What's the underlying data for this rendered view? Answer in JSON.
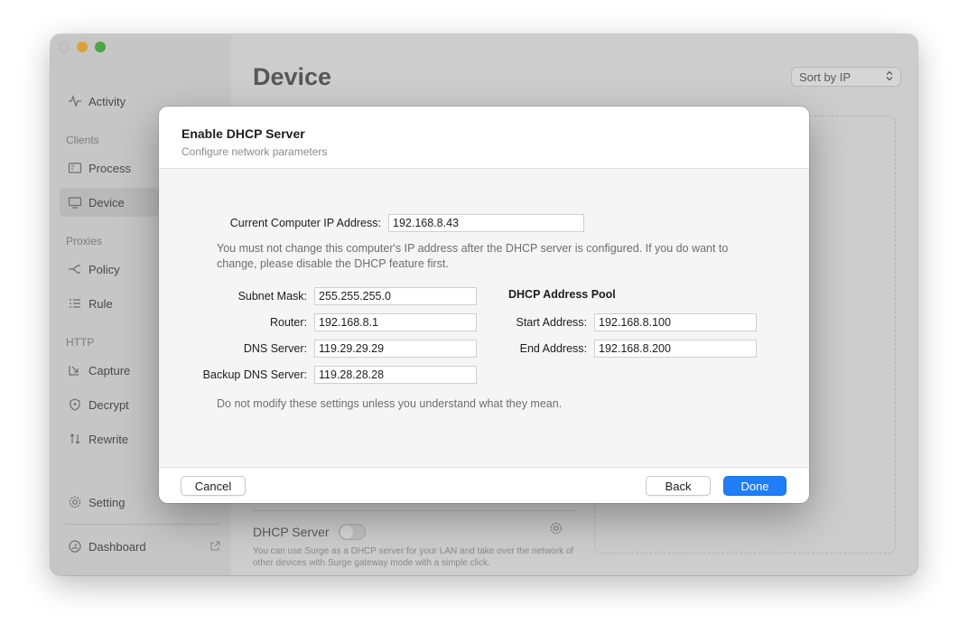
{
  "sidebar": {
    "items": [
      {
        "key": "activity",
        "label": "Activity",
        "icon": "pulse-icon"
      },
      {
        "key": "process",
        "label": "Process",
        "icon": "process-window-icon"
      },
      {
        "key": "device",
        "label": "Device",
        "icon": "monitor-icon",
        "active": true
      },
      {
        "key": "policy",
        "label": "Policy",
        "icon": "policy-branch-icon"
      },
      {
        "key": "rule",
        "label": "Rule",
        "icon": "rule-list-icon"
      },
      {
        "key": "capture",
        "label": "Capture",
        "icon": "capture-icon"
      },
      {
        "key": "decrypt",
        "label": "Decrypt",
        "icon": "shield-icon"
      },
      {
        "key": "rewrite",
        "label": "Rewrite",
        "icon": "rewrite-arrows-icon"
      },
      {
        "key": "setting",
        "label": "Setting",
        "icon": "gear-icon"
      },
      {
        "key": "dashboard",
        "label": "Dashboard",
        "icon": "dashboard-icon"
      }
    ],
    "sections": {
      "clients": "Clients",
      "proxies": "Proxies",
      "http": "HTTP"
    }
  },
  "main": {
    "title": "Device",
    "sort_value": "Sort by IP",
    "dhcp_title": "DHCP Server",
    "dhcp_toggle_on": false,
    "dhcp_desc": "You can use Surge as a DHCP server for your LAN and take over the network of other devices with Surge gateway mode with a simple click."
  },
  "dialog": {
    "title": "Enable DHCP Server",
    "subtitle": "Configure network parameters",
    "current_ip_label": "Current Computer IP Address:",
    "current_ip_value": "192.168.8.43",
    "ip_note": "You must not change this computer's IP address after the DHCP server is configured. If you do want to change, please disable the DHCP feature first.",
    "subnet_label": "Subnet Mask:",
    "subnet_value": "255.255.255.0",
    "router_label": "Router:",
    "router_value": "192.168.8.1",
    "dns_label": "DNS Server:",
    "dns_value": "119.29.29.29",
    "backup_dns_label": "Backup DNS Server:",
    "backup_dns_value": "119.28.28.28",
    "pool_heading": "DHCP Address Pool",
    "start_label": "Start Address:",
    "start_value": "192.168.8.100",
    "end_label": "End Address:",
    "end_value": "192.168.8.200",
    "warning_note": "Do not modify these settings unless you understand what they mean.",
    "cancel_label": "Cancel",
    "back_label": "Back",
    "done_label": "Done"
  },
  "colors": {
    "accent": "#1f7ef6",
    "traffic_yellow": "#d9a33a",
    "traffic_green": "#4ca544"
  }
}
